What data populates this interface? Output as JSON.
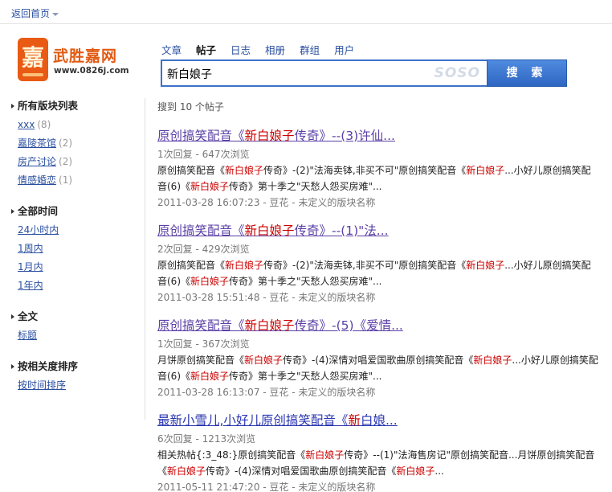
{
  "topbar": {
    "back_label": "返回首页"
  },
  "logo": {
    "glyph": "嘉",
    "name": "武胜嘉网",
    "url": "www.0826j.com"
  },
  "tabs": [
    {
      "label": "文章",
      "active": false
    },
    {
      "label": "帖子",
      "active": true
    },
    {
      "label": "日志",
      "active": false
    },
    {
      "label": "相册",
      "active": false
    },
    {
      "label": "群组",
      "active": false
    },
    {
      "label": "用户",
      "active": false
    }
  ],
  "search": {
    "value": "新白娘子",
    "brand": "SOSO",
    "button_label": "搜 索"
  },
  "sidebar": {
    "boards": {
      "heading": "所有版块列表",
      "items": [
        {
          "label": "xxx",
          "count": "(8)"
        },
        {
          "label": "嘉陵茶馆",
          "count": "(2)"
        },
        {
          "label": "房产讨论",
          "count": "(2)"
        },
        {
          "label": "情感婚恋",
          "count": "(1)"
        }
      ]
    },
    "time": {
      "heading": "全部时间",
      "items": [
        {
          "label": "24小时内"
        },
        {
          "label": "1周内"
        },
        {
          "label": "1月内"
        },
        {
          "label": "1年内"
        }
      ]
    },
    "fulltext": {
      "heading": "全文",
      "items": [
        {
          "label": "标题"
        }
      ]
    },
    "sort": {
      "heading": "按相关度排序",
      "items": [
        {
          "label": "按时间排序"
        }
      ]
    }
  },
  "results": {
    "summary": "搜到 10 个帖子",
    "items": [
      {
        "title_pre": "原创搞笑配音《",
        "title_hl": "新白娘子",
        "title_post": "传奇》--(3)许仙...",
        "meta": "1次回复 - 647次浏览",
        "snippet1": [
          {
            "t": "原创搞笑配音《",
            "hl": false
          },
          {
            "t": "新白娘子",
            "hl": true
          },
          {
            "t": "传奇》-(2)\"法海卖钵,非买不可\"原创搞笑配音《",
            "hl": false
          },
          {
            "t": "新白娘子",
            "hl": true
          },
          {
            "t": "...小好儿原创搞笑配",
            "hl": false
          }
        ],
        "snippet2": [
          {
            "t": "音(6)《",
            "hl": false
          },
          {
            "t": "新白娘子",
            "hl": true
          },
          {
            "t": "传奇》第十季之\"天愁人怨买房难\"...",
            "hl": false
          }
        ],
        "foot": "2011-03-28 16:07:23 - 豆花 - 未定义的版块名称"
      },
      {
        "title_pre": "原创搞笑配音《",
        "title_hl": "新白娘子",
        "title_post": "传奇》--(1)\"法...",
        "meta": "2次回复 - 429次浏览",
        "snippet1": [
          {
            "t": "原创搞笑配音《",
            "hl": false
          },
          {
            "t": "新白娘子",
            "hl": true
          },
          {
            "t": "传奇》-(2)\"法海卖钵,非买不可\"原创搞笑配音《",
            "hl": false
          },
          {
            "t": "新白娘子",
            "hl": true
          },
          {
            "t": "...小好儿原创搞笑配",
            "hl": false
          }
        ],
        "snippet2": [
          {
            "t": "音(6)《",
            "hl": false
          },
          {
            "t": "新白娘子",
            "hl": true
          },
          {
            "t": "传奇》第十季之\"天愁人怨买房难\"...",
            "hl": false
          }
        ],
        "foot": "2011-03-28 15:51:48 - 豆花 - 未定义的版块名称"
      },
      {
        "title_pre": "原创搞笑配音《",
        "title_hl": "新白娘子",
        "title_post": "传奇》-(5)《爱情...",
        "meta": "1次回复 - 367次浏览",
        "snippet1": [
          {
            "t": "月饼原创搞笑配音《",
            "hl": false
          },
          {
            "t": "新白娘子",
            "hl": true
          },
          {
            "t": "传奇》-(4)深情对唱爱国歌曲原创搞笑配音《",
            "hl": false
          },
          {
            "t": "新白娘子",
            "hl": true
          },
          {
            "t": "...小好儿原创搞笑配",
            "hl": false
          }
        ],
        "snippet2": [
          {
            "t": "音(6)《",
            "hl": false
          },
          {
            "t": "新白娘子",
            "hl": true
          },
          {
            "t": "传奇》第十季之\"天愁人怨买房难\"...",
            "hl": false
          }
        ],
        "foot": "2011-03-28 16:13:07 - 豆花 - 未定义的版块名称"
      },
      {
        "title_pre": "最新小雪儿,小好儿原创搞笑配音《",
        "title_hl": "新",
        "title_post": "白娘...",
        "meta": "6次回复 - 1213次浏览",
        "snippet1": [
          {
            "t": "相关热帖{:3_48:}原创搞笑配音《",
            "hl": false
          },
          {
            "t": "新白娘子",
            "hl": true
          },
          {
            "t": "传奇》--(1)\"法海售房记\"原创搞笑配音...月饼原创搞笑配音",
            "hl": false
          }
        ],
        "snippet2": [
          {
            "t": "《",
            "hl": false
          },
          {
            "t": "新白娘子",
            "hl": true
          },
          {
            "t": "传奇》-(4)深情对唱爱国歌曲原创搞笑配音《",
            "hl": false
          },
          {
            "t": "新白娘子",
            "hl": true
          },
          {
            "t": "...",
            "hl": false
          }
        ],
        "foot": "2011-05-11 21:47:20 - 豆花 - 未定义的版块名称"
      }
    ]
  }
}
